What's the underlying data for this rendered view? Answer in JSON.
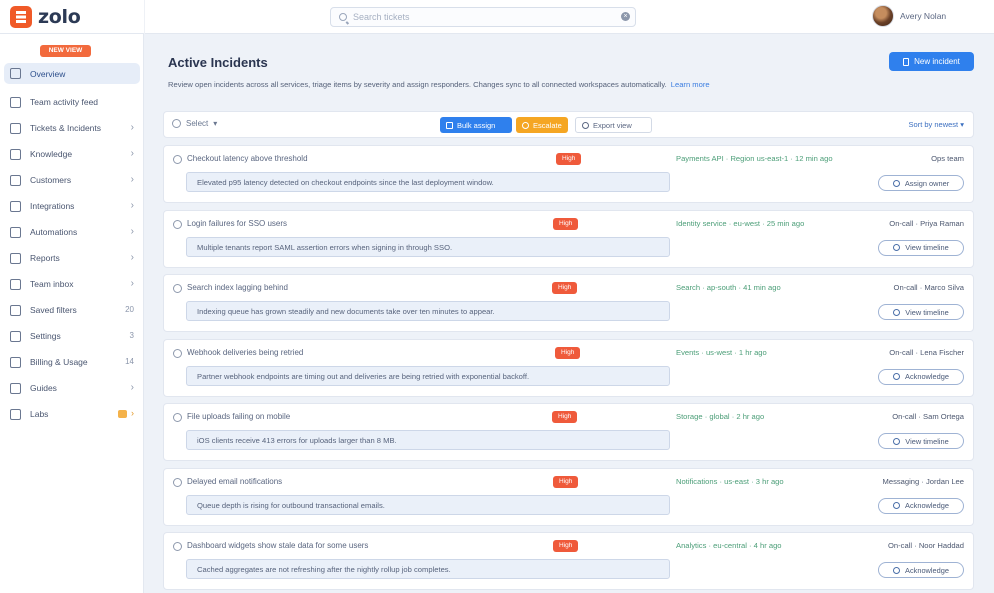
{
  "brand": {
    "name": "zolo",
    "color": "#f05a28",
    "logo_icon": "list-logo-icon"
  },
  "search": {
    "placeholder": "Search tickets",
    "icon": "search-icon"
  },
  "user": {
    "name": "Avery Nolan"
  },
  "sidebar": {
    "badge": "NEW VIEW",
    "items": [
      {
        "label": "Overview",
        "icon": "overview-icon",
        "active": true,
        "suffix": ""
      },
      {
        "label": "Team activity feed",
        "icon": "activity-icon",
        "suffix": ""
      },
      {
        "label": "Tickets & Incidents",
        "icon": "ticket-icon",
        "suffix": "chevron"
      },
      {
        "label": "Knowledge",
        "icon": "book-icon",
        "suffix": "chevron"
      },
      {
        "label": "Customers",
        "icon": "customer-icon",
        "suffix": "chevron"
      },
      {
        "label": "Integrations",
        "icon": "plug-icon",
        "suffix": "chevron"
      },
      {
        "label": "Automations",
        "icon": "automation-icon",
        "suffix": "chevron"
      },
      {
        "label": "Reports",
        "icon": "chart-icon",
        "suffix": "chevron"
      },
      {
        "label": "Team inbox",
        "icon": "inbox-icon",
        "suffix": "chevron"
      },
      {
        "label": "Saved filters",
        "icon": "filter-icon",
        "suffix": "count",
        "count": "20"
      },
      {
        "label": "Settings",
        "icon": "gear-icon",
        "suffix": "count",
        "count": "3"
      },
      {
        "label": "Billing & Usage",
        "icon": "card-icon",
        "suffix": "count",
        "count": "14"
      },
      {
        "label": "Guides",
        "icon": "guide-icon",
        "suffix": "chevron"
      },
      {
        "label": "Labs",
        "icon": "labs-icon",
        "suffix": "new"
      }
    ]
  },
  "main": {
    "title": "Active Incidents",
    "description": "Review open incidents across all services, triage items by severity and assign responders. Changes sync to all connected workspaces automatically.",
    "description_link": "Learn more",
    "primary_button": "New incident",
    "toolbar": {
      "select_label": "Select",
      "bulk_assign": "Bulk assign",
      "escalate": "Escalate",
      "export": "Export view",
      "sort": "Sort by newest"
    },
    "rows": [
      {
        "title": "Checkout latency above threshold",
        "badge": "High",
        "meta": "Payments API · Region us-east-1 · 12 min ago",
        "right": "Ops team",
        "note": "Elevated p95 latency detected on checkout endpoints since the last deployment window.",
        "action": "Assign owner"
      },
      {
        "title": "Login failures for SSO users",
        "badge": "High",
        "meta": "Identity service · eu-west · 25 min ago",
        "right": "On-call · Priya Raman",
        "note": "Multiple tenants report SAML assertion errors when signing in through SSO.",
        "action": "View timeline"
      },
      {
        "title": "Search index lagging behind",
        "badge": "High",
        "meta": "Search · ap-south · 41 min ago",
        "right": "On-call · Marco Silva",
        "note": "Indexing queue has grown steadily and new documents take over ten minutes to appear.",
        "action": "View timeline"
      },
      {
        "title": "Webhook deliveries being retried",
        "badge": "High",
        "meta": "Events · us-west · 1 hr ago",
        "right": "On-call · Lena Fischer",
        "note": "Partner webhook endpoints are timing out and deliveries are being retried with exponential backoff.",
        "action": "Acknowledge"
      },
      {
        "title": "File uploads failing on mobile",
        "badge": "High",
        "meta": "Storage · global · 2 hr ago",
        "right": "On-call · Sam Ortega",
        "note": "iOS clients receive 413 errors for uploads larger than 8 MB.",
        "action": "View timeline"
      },
      {
        "title": "Delayed email notifications",
        "badge": "High",
        "meta": "Notifications · us-east · 3 hr ago",
        "right": "Messaging · Jordan Lee",
        "note": "Queue depth is rising for outbound transactional emails.",
        "action": "Acknowledge"
      },
      {
        "title": "Dashboard widgets show stale data for some users",
        "badge": "High",
        "meta": "Analytics · eu-central · 4 hr ago",
        "right": "On-call · Noor Haddad",
        "note": "Cached aggregates are not refreshing after the nightly rollup job completes.",
        "action": "Acknowledge"
      }
    ]
  },
  "colors": {
    "accent": "#2f80ed",
    "danger": "#ef5a3b",
    "warning": "#f5a623",
    "success_text": "#4c9e78"
  }
}
